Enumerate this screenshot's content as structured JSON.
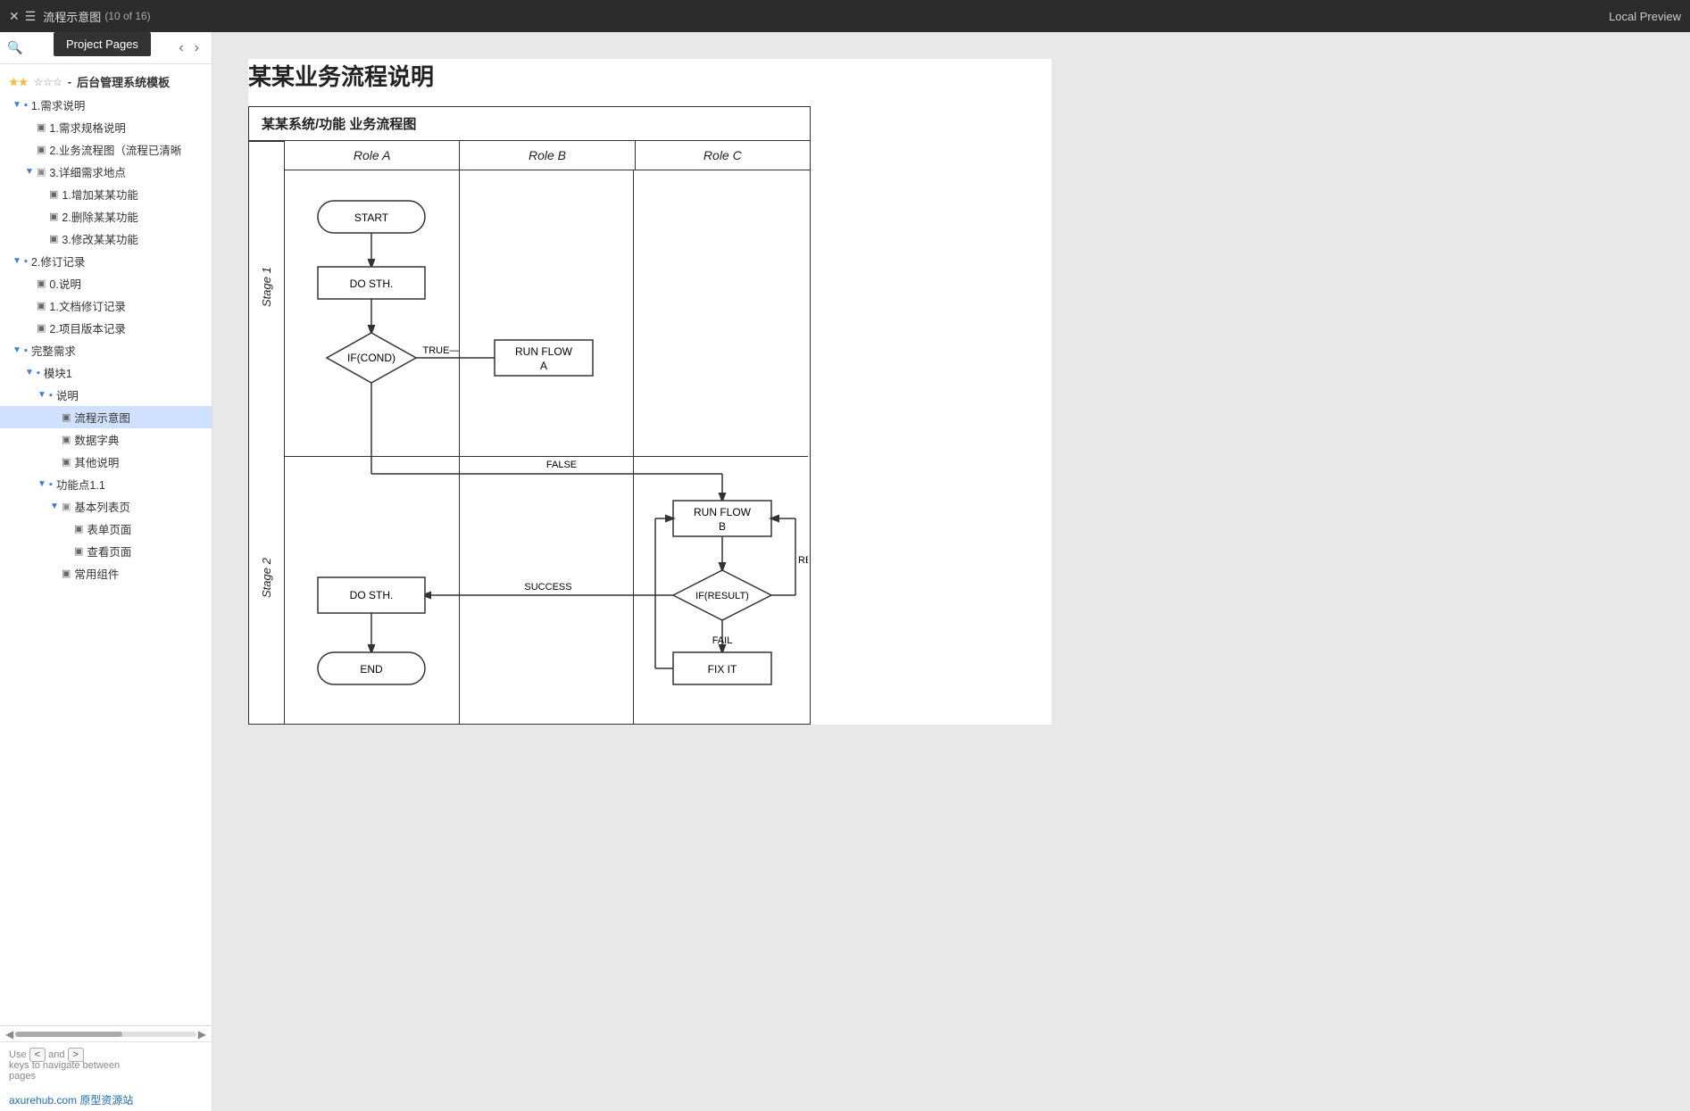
{
  "topbar": {
    "menu_icon": "☰",
    "flow_title": "流程示意图",
    "page_count": "(10 of 16)",
    "local_preview": "Local Preview"
  },
  "project_pages_popup": "Project Pages",
  "sidebar": {
    "search_icon": "🔍",
    "nav_prev": "‹",
    "nav_next": "›",
    "project_title": "后台管理系统模板",
    "stars_filled": "★★",
    "stars_empty": "☆☆☆",
    "items": [
      {
        "label": "1.需求说明",
        "indent": 1,
        "type": "folder",
        "expanded": true,
        "arrow": "▼"
      },
      {
        "label": "1.需求规格说明",
        "indent": 2,
        "type": "page"
      },
      {
        "label": "2.业务流程图（流程已清晰",
        "indent": 2,
        "type": "page"
      },
      {
        "label": "3.详细需求地点",
        "indent": 2,
        "type": "folder",
        "expanded": true,
        "arrow": "▼"
      },
      {
        "label": "1.增加某某功能",
        "indent": 3,
        "type": "page"
      },
      {
        "label": "2.删除某某功能",
        "indent": 3,
        "type": "page"
      },
      {
        "label": "3.修改某某功能",
        "indent": 3,
        "type": "page"
      },
      {
        "label": "2.修订记录",
        "indent": 1,
        "type": "folder",
        "expanded": true,
        "arrow": "▼"
      },
      {
        "label": "0.说明",
        "indent": 2,
        "type": "page"
      },
      {
        "label": "1.文档修订记录",
        "indent": 2,
        "type": "page"
      },
      {
        "label": "2.项目版本记录",
        "indent": 2,
        "type": "page"
      },
      {
        "label": "完整需求",
        "indent": 1,
        "type": "folder",
        "expanded": true,
        "arrow": "▼"
      },
      {
        "label": "模块1",
        "indent": 2,
        "type": "folder",
        "expanded": true,
        "arrow": "▼"
      },
      {
        "label": "说明",
        "indent": 3,
        "type": "folder",
        "expanded": true,
        "arrow": "▼"
      },
      {
        "label": "流程示意图",
        "indent": 4,
        "type": "page",
        "active": true
      },
      {
        "label": "数据字典",
        "indent": 4,
        "type": "page"
      },
      {
        "label": "其他说明",
        "indent": 4,
        "type": "page"
      },
      {
        "label": "功能点1.1",
        "indent": 3,
        "type": "folder",
        "expanded": true,
        "arrow": "▼"
      },
      {
        "label": "基本列表页",
        "indent": 4,
        "type": "folder",
        "expanded": true,
        "arrow": "▼"
      },
      {
        "label": "表单页面",
        "indent": 5,
        "type": "page"
      },
      {
        "label": "查看页面",
        "indent": 5,
        "type": "page"
      },
      {
        "label": "常用组件",
        "indent": 4,
        "type": "page"
      }
    ],
    "hint_use": "Use",
    "hint_and": "and",
    "hint_keys": "keys",
    "hint_navigate": "to navigate",
    "hint_between": "between",
    "hint_pages": "pages",
    "key_prev": "<",
    "key_next": ">",
    "axure_link": "axurehub.com  原型资源站"
  },
  "preview": {
    "page_title": "某某业务流程说明",
    "flowchart_title": "某某系统/功能 业务流程图",
    "roles": [
      "Role A",
      "Role B",
      "Role C"
    ],
    "stages": [
      "Stage 1",
      "Stage 2"
    ],
    "nodes": {
      "start": "START",
      "do_sth_1": "DO STH.",
      "if_cond": "IF(COND)",
      "run_flow_a": "RUN FLOW\nA",
      "false_label": "FALSE",
      "true_label": "TRUE—",
      "run_flow_b": "RUN FLOW\nB",
      "if_result": "IF(RESULT)",
      "retry_label": "RETRY",
      "success_label": "SUCCESS",
      "fail_label": "FAIL",
      "do_sth_2": "DO STH.",
      "fix_it": "FIX IT",
      "end": "END"
    }
  }
}
